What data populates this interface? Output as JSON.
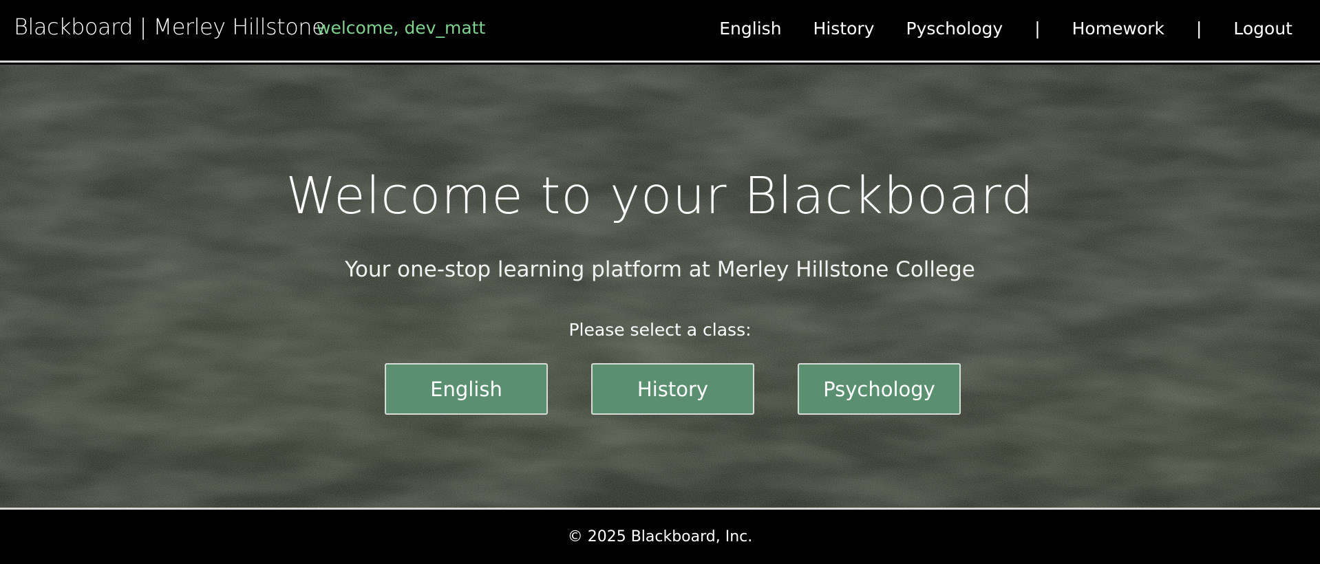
{
  "header": {
    "brand": "Blackboard | Merley Hillstone",
    "welcome": "welcome, dev_matt",
    "nav": {
      "english": "English",
      "history": "History",
      "psychology": "Pyschology",
      "sep1": "|",
      "homework": "Homework",
      "sep2": "|",
      "logout": "Logout"
    }
  },
  "hero": {
    "title": "Welcome to your Blackboard",
    "subtitle": "Your one-stop learning platform at Merley Hillstone College",
    "prompt": "Please select a class:",
    "classes": [
      {
        "label": "English"
      },
      {
        "label": "History"
      },
      {
        "label": "Psychology"
      }
    ]
  },
  "footer": {
    "copyright": "© 2025 Blackboard, Inc."
  },
  "colors": {
    "welcome_text": "#7fd28f",
    "button_bg": "#5a9070",
    "button_border": "#d8dcd8",
    "bar_bg": "#000000",
    "divider": "#d9d9d9"
  }
}
